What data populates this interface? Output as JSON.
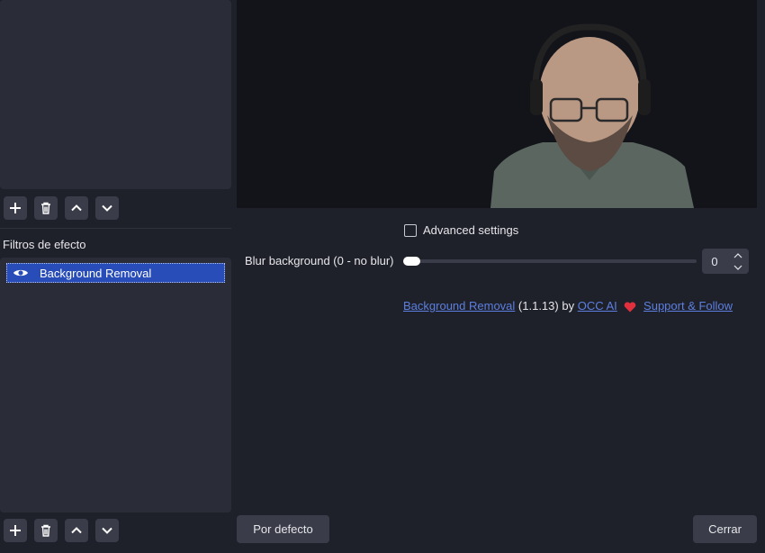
{
  "sources_toolbar": {
    "add": "add-icon",
    "remove": "trash-icon",
    "up": "chevron-up-icon",
    "down": "chevron-down-icon"
  },
  "effect_filters": {
    "title": "Filtros de efecto",
    "items": [
      {
        "label": "Background Removal",
        "visible": true
      }
    ]
  },
  "settings": {
    "advanced_label": "Advanced settings",
    "advanced_checked": false,
    "blur_label": "Blur background (0 - no blur)",
    "blur_value": "0",
    "blur_level": 0
  },
  "credits": {
    "plugin_link": "Background Removal",
    "version": "(1.1.13)",
    "by": "by",
    "author_link": "OCC AI",
    "support_link": "Support & Follow"
  },
  "footer": {
    "defaults_label": "Por defecto",
    "close_label": "Cerrar"
  },
  "colors": {
    "accent": "#284cb8",
    "link": "#5c7fe0",
    "heart": "#e0303e"
  }
}
